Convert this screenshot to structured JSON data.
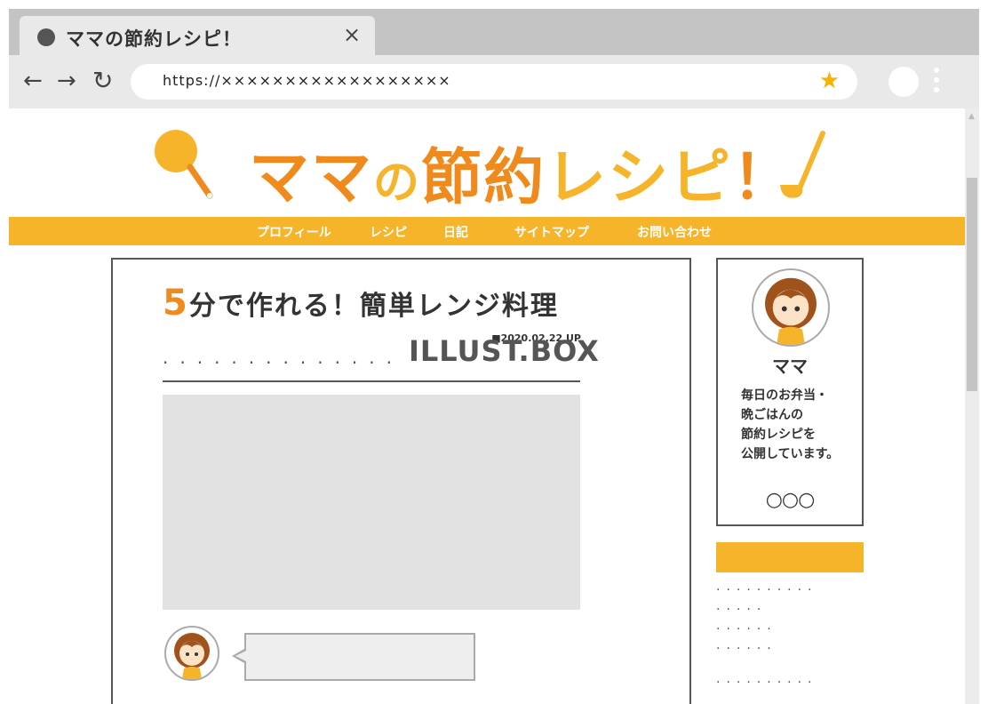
{
  "browser": {
    "tab_title": "ママの節約レシピ！",
    "tab_close": "×",
    "back": "←",
    "forward": "→",
    "reload": "↻",
    "url": "https://××××××××××××××××××",
    "bookmark": "★"
  },
  "site": {
    "logo_text": "ママの節約レシピ！",
    "nav": [
      "プロフィール",
      "レシピ",
      "日記",
      "サイトマップ",
      "お問い合わせ"
    ]
  },
  "article": {
    "title_num": "5",
    "title_rest": "分で作れる！簡単レンジ料理",
    "date": "■2020.02.22 UP",
    "dots": "..............",
    "watermark": "ILLUST.BOX"
  },
  "profile": {
    "name": "ママ",
    "bio": "毎日のお弁当・\n晩ごはんの\n節約レシピを\n公開しています。",
    "links": "○○○"
  },
  "sidebar": {
    "dots": [
      "..........",
      ".....",
      "......",
      "......",
      ".........."
    ]
  },
  "colors": {
    "accent": "#f6b42a",
    "orange": "#f08a1c"
  }
}
